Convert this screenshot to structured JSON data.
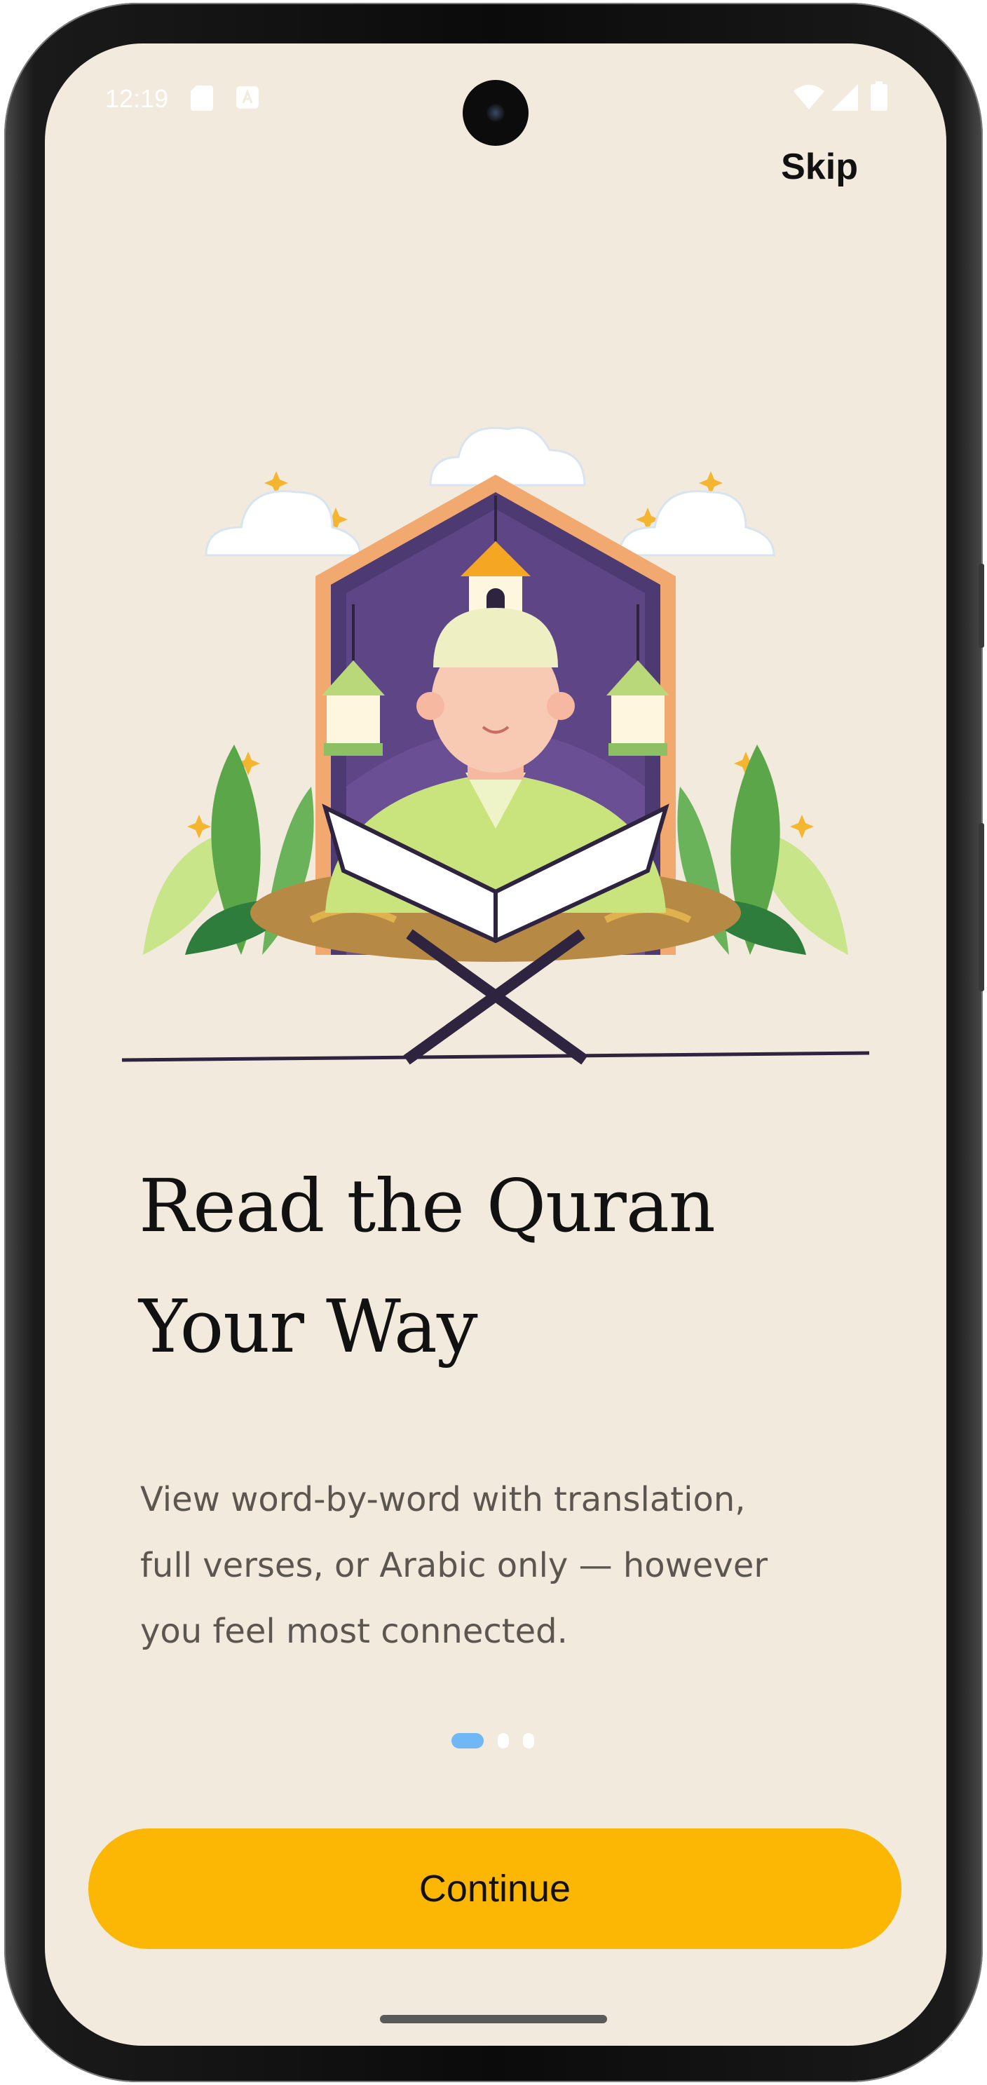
{
  "status_bar": {
    "time": "12:19",
    "left_icons": [
      "sd-card-icon",
      "app-notification-icon"
    ],
    "right_icons": [
      "wifi-icon",
      "signal-icon",
      "battery-icon"
    ]
  },
  "header": {
    "skip_label": "Skip"
  },
  "onboarding": {
    "title_line1": "Read the Quran",
    "title_line2": "Your Way",
    "description_line1": "View word-by-word with translation,",
    "description_line2": "full verses, or Arabic only — however",
    "description_line3": "you feel most connected.",
    "page_indicator": {
      "current": 1,
      "total": 3
    },
    "continue_label": "Continue"
  },
  "colors": {
    "background": "#f2ebdd",
    "accent": "#fbb703",
    "active_dot": "#6fb8f5",
    "inactive_dot": "#ffffff",
    "arch_purple": "#4e3a72",
    "arch_border": "#f2a970"
  }
}
